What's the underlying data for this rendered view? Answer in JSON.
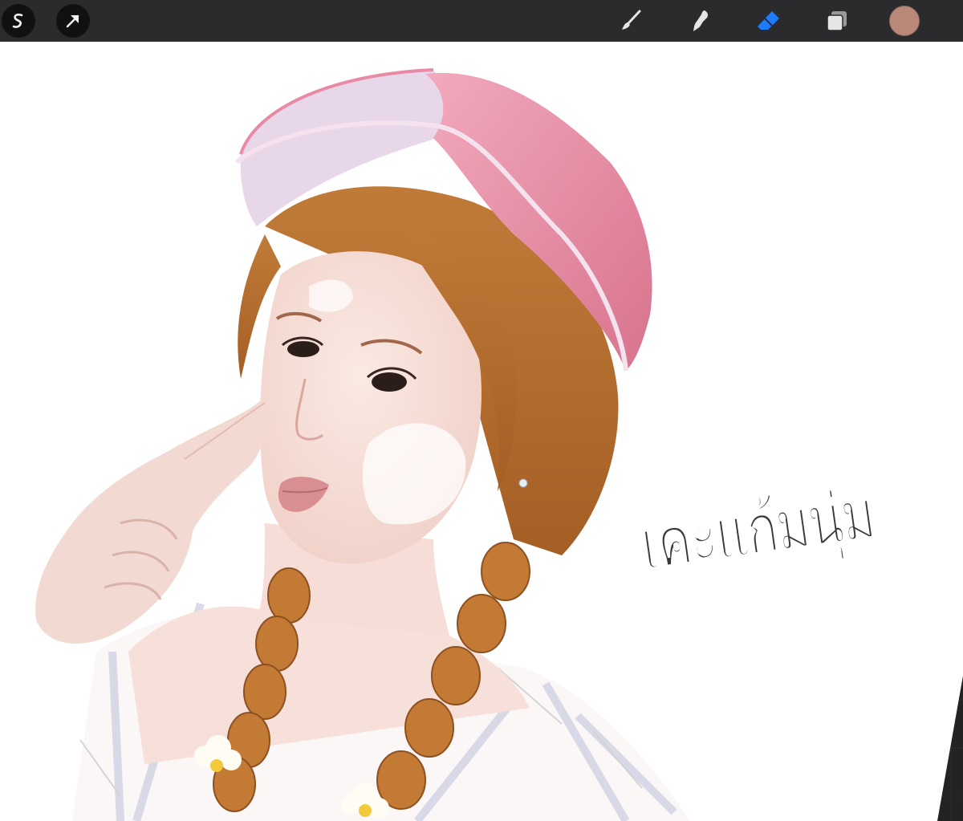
{
  "app": {
    "toolbar_left": [
      {
        "icon": "modify-s-icon"
      },
      {
        "icon": "selection-arrow-icon"
      }
    ],
    "toolbar_right": [
      {
        "icon": "brush-icon",
        "active": false
      },
      {
        "icon": "smudge-icon",
        "active": false
      },
      {
        "icon": "eraser-icon",
        "active": true
      },
      {
        "icon": "layers-icon",
        "active": false
      },
      {
        "icon": "color-swatch-icon",
        "color": "#b98878"
      }
    ],
    "accent_color": "#1e7bff"
  },
  "canvas": {
    "text_overlay": "เคะแก้มนุ่ม"
  }
}
